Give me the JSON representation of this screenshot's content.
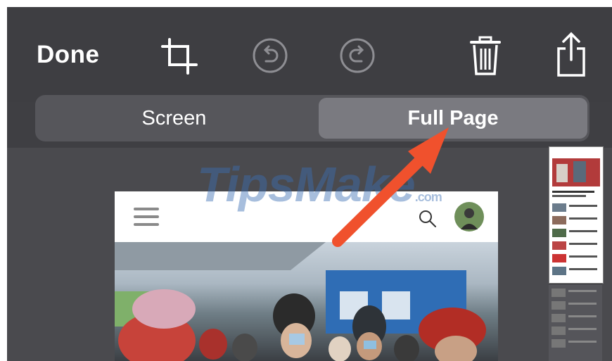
{
  "toolbar": {
    "done_label": "Done",
    "icons": [
      "crop-icon",
      "undo-icon",
      "redo-icon",
      "trash-icon",
      "share-icon"
    ]
  },
  "segmented": {
    "options": [
      {
        "label": "Screen",
        "selected": false
      },
      {
        "label": "Full Page",
        "selected": true
      }
    ]
  },
  "watermark": {
    "text": "TipsMake",
    "suffix": ".com"
  },
  "colors": {
    "accent_arrow": "#f0512d",
    "toolbar_bg": "#3e3e42"
  }
}
